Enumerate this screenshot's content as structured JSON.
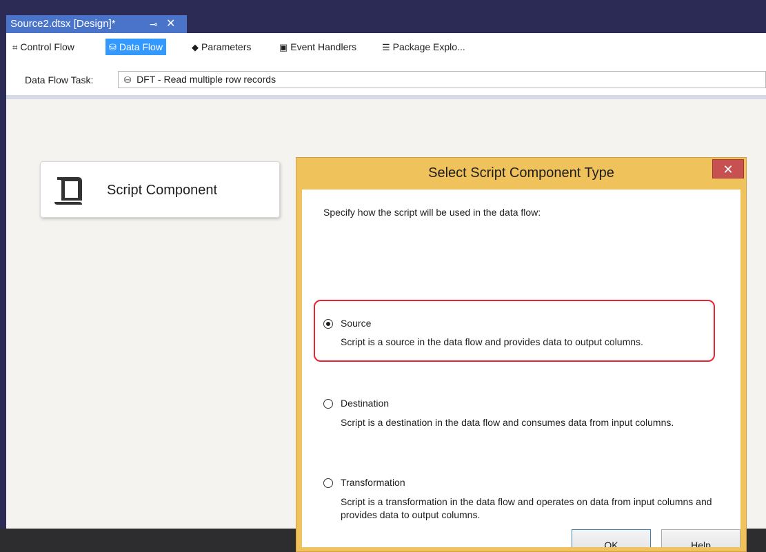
{
  "document_tab": {
    "title": "Source2.dtsx [Design]*",
    "pin_glyph": "⊸",
    "close_glyph": "✕"
  },
  "designer_tabs": [
    {
      "label": "Control Flow",
      "icon": "control-flow-icon",
      "glyph": "⌗"
    },
    {
      "label": "Data Flow",
      "icon": "data-flow-icon",
      "glyph": "⛁"
    },
    {
      "label": "Parameters",
      "icon": "parameters-icon",
      "glyph": "◆"
    },
    {
      "label": "Event Handlers",
      "icon": "event-handlers-icon",
      "glyph": "▣"
    },
    {
      "label": "Package Explo...",
      "icon": "package-explorer-icon",
      "glyph": "☰"
    }
  ],
  "task_bar": {
    "label": "Data Flow Task:",
    "value": "DFT - Read multiple row records",
    "icon_glyph": "⛁"
  },
  "component": {
    "label": "Script Component"
  },
  "dialog": {
    "title": "Select Script Component Type",
    "close_glyph": "✕",
    "instruction": "Specify how the script will be used in the data flow:",
    "options": [
      {
        "label": "Source",
        "desc": "Script is a source in the data flow and provides data to output columns.",
        "selected": true
      },
      {
        "label": "Destination",
        "desc": "Script is a destination in the data flow and consumes data from input columns.",
        "selected": false
      },
      {
        "label": "Transformation",
        "desc": "Script is a transformation in the data flow and operates on data from input columns and provides data to output columns.",
        "selected": false
      }
    ],
    "ok_label": "OK",
    "help_label": "Help"
  },
  "colors": {
    "accent": "#3399ff",
    "highlight": "#e8232e",
    "dialog_frame": "#f0c25c",
    "close": "#c75050"
  }
}
